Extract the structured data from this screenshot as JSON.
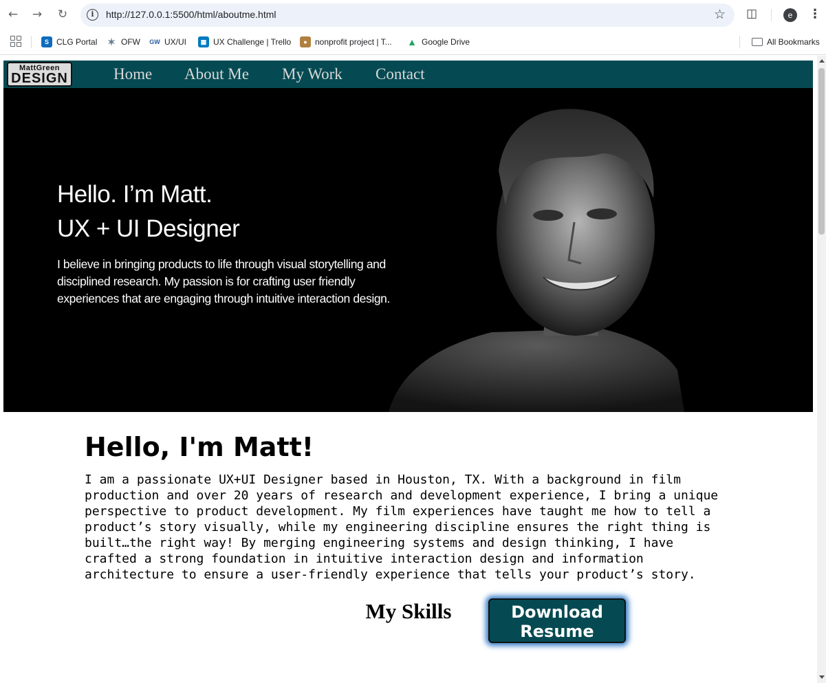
{
  "browser": {
    "url": "http://127.0.0.1:5500/html/aboutme.html",
    "profile_initial": "e",
    "bookmarks": [
      {
        "label": "CLG Portal",
        "icon": "sharepoint-icon",
        "color": "#0f6cbd"
      },
      {
        "label": "OFW",
        "icon": "ofw-icon",
        "color": "#6b7c93"
      },
      {
        "label": "UX/UI",
        "icon": "gw-icon",
        "color": "#2c5aa0"
      },
      {
        "label": "UX Challenge | Trello",
        "icon": "trello-icon",
        "color": "#0079bf"
      },
      {
        "label": "nonprofit project | T...",
        "icon": "nonprofit-icon",
        "color": "#b08040"
      },
      {
        "label": "Google Drive",
        "icon": "google-drive-icon",
        "color": "#1fa463"
      }
    ],
    "all_bookmarks": "All Bookmarks"
  },
  "site": {
    "logo_line1": "MattGreen",
    "logo_line2": "DESIGN",
    "nav": [
      "Home",
      "About Me",
      "My Work",
      "Contact"
    ],
    "brand_color": "#054a52"
  },
  "hero": {
    "line1": "Hello. I’m Matt.",
    "line2": "UX + UI Designer",
    "paragraph": "I believe in bringing products to life through visual storytelling and disciplined research. My passion is for crafting user friendly experiences that are engaging through intuitive interaction design."
  },
  "about": {
    "heading": "Hello, I'm Matt!",
    "bio": "I am a passionate UX+UI Designer based in Houston, TX. With a background in film production and over 20 years of research and development experience, I bring a unique perspective to product development. My film experiences have taught me how to tell a product’s story visually, while my engineering discipline ensures the right thing is built…the right way! By merging engineering systems and design thinking, I have crafted a strong foundation in intuitive interaction design and information architecture to ensure a user-friendly experience that tells your product’s story.",
    "download_line1": "Download",
    "download_line2": "Resume",
    "skills_heading": "My Skills"
  }
}
